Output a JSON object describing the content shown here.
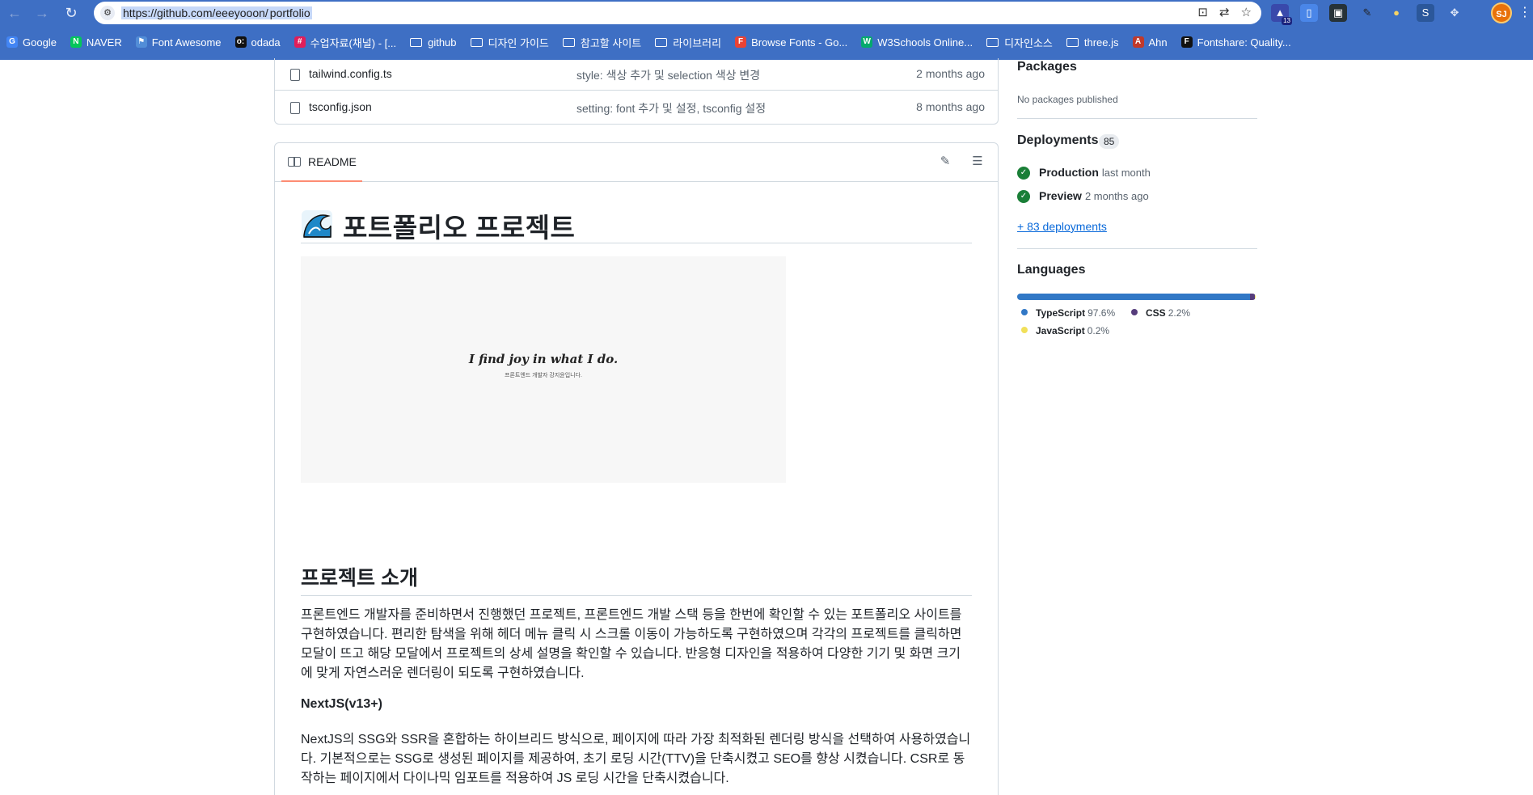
{
  "browser": {
    "url_prefix": "https://github.com/eeeyooon/",
    "url_rest": "portfolio",
    "profile_initials": "SJ",
    "extension_badge": "13",
    "bookmarks": [
      {
        "label": "Google",
        "icon": "google-icon",
        "color": "#4285f4",
        "glyph": "G"
      },
      {
        "label": "NAVER",
        "icon": "naver-icon",
        "color": "#03c75a",
        "glyph": "N"
      },
      {
        "label": "Font Awesome",
        "icon": "flag-icon",
        "color": "#528dd7",
        "glyph": "⚑"
      },
      {
        "label": "odada",
        "icon": "odada-icon",
        "color": "#111111",
        "glyph": "o:"
      },
      {
        "label": "수업자료(채널) - [...",
        "icon": "slack-icon",
        "color": "#e01e5a",
        "glyph": "#"
      },
      {
        "label": "github",
        "icon": "folder-icon",
        "folder": true
      },
      {
        "label": "디자인 가이드",
        "icon": "folder-icon",
        "folder": true
      },
      {
        "label": "참고할 사이트",
        "icon": "folder-icon",
        "folder": true
      },
      {
        "label": "라이브러리",
        "icon": "folder-icon",
        "folder": true
      },
      {
        "label": "Browse Fonts - Go...",
        "icon": "google-fonts-icon",
        "color": "#ea4335",
        "glyph": "F"
      },
      {
        "label": "W3Schools Online...",
        "icon": "w3schools-icon",
        "color": "#04aa6d",
        "glyph": "W"
      },
      {
        "label": "디자인소스",
        "icon": "folder-icon",
        "folder": true
      },
      {
        "label": "three.js",
        "icon": "folder-icon",
        "folder": true
      },
      {
        "label": "Ahn",
        "icon": "ahn-icon",
        "color": "#c0392b",
        "glyph": "A"
      },
      {
        "label": "Fontshare: Quality...",
        "icon": "fontshare-icon",
        "color": "#111111",
        "glyph": "F"
      }
    ]
  },
  "files": [
    {
      "name": "tailwind.config.ts",
      "message": "style: 색상 추가 및 selection 색상 변경",
      "date": "2 months ago"
    },
    {
      "name": "tsconfig.json",
      "message": "setting: font 추가 및 설정, tsconfig 설정",
      "date": "8 months ago"
    }
  ],
  "readme": {
    "tab_label": "README",
    "title": "포트폴리오 프로젝트",
    "preview_title": "I find joy in what I do.",
    "preview_subtitle": "프론트엔드 개발자 강지윤입니다.",
    "section_title": "프로젝트 소개",
    "intro": "프론트엔드 개발자를 준비하면서 진행했던 프로젝트, 프론트엔드 개발 스택 등을 한번에 확인할 수 있는 포트폴리오 사이트를 구현하였습니다. 편리한 탐색을 위해 헤더 메뉴 클릭 시 스크롤 이동이 가능하도록 구현하였으며 각각의 프로젝트를 클릭하면 모달이 뜨고 해당 모달에서 프로젝트의 상세 설명을 확인할 수 있습니다. 반응형 디자인을 적용하여 다양한 기기 및 화면 크기에 맞게 자연스러운 렌더링이 되도록 구현하였습니다.",
    "subsection_title": "NextJS(v13+)",
    "nextjs_text": "NextJS의 SSG와 SSR을 혼합하는 하이브리드 방식으로, 페이지에 따라 가장 최적화된 렌더링 방식을 선택하여 사용하였습니다. 기본적으로는 SSG로 생성된 페이지를 제공하여, 초기 로딩 시간(TTV)을 단축시켰고 SEO를 향상 시켰습니다. CSR로 동작하는 페이지에서 다이나믹 임포트를 적용하여 JS 로딩 시간을 단축시켰습니다."
  },
  "sidebar": {
    "packages_title": "Packages",
    "packages_text": "No packages published",
    "deployments_title": "Deployments",
    "deployments_count": "85",
    "deployments": [
      {
        "name": "Production",
        "time": "last month"
      },
      {
        "name": "Preview",
        "time": "2 months ago"
      }
    ],
    "more_deployments": "+ 83 deployments",
    "languages_title": "Languages",
    "languages": [
      {
        "name": "TypeScript",
        "percent": "97.6%",
        "value": 97.6,
        "color": "#3178c6"
      },
      {
        "name": "CSS",
        "percent": "2.2%",
        "value": 2.2,
        "color": "#563d7c"
      },
      {
        "name": "JavaScript",
        "percent": "0.2%",
        "value": 0.2,
        "color": "#f1e05a"
      }
    ]
  }
}
